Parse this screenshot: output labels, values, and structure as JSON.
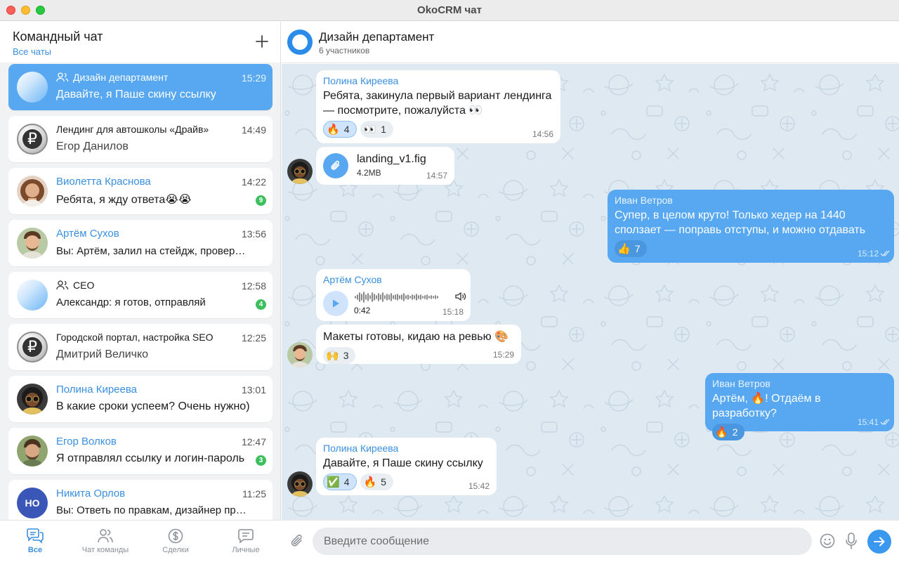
{
  "window": {
    "title": "OkoCRM чат"
  },
  "sidebar": {
    "title": "Командный чат",
    "subtitle": "Все чаты",
    "chats": [
      {
        "name": "Дизайн департамент",
        "time": "15:29",
        "preview": "Давайте, я Паше скину ссылку",
        "group": true,
        "active": true
      },
      {
        "name": "Лендинг для автошколы «Драйв»",
        "time": "14:49",
        "preview": "Егор Данилов"
      },
      {
        "name": "Виолетта Краснова",
        "time": "14:22",
        "preview": "Ребята, я жду ответа😭😭",
        "unread": "9"
      },
      {
        "name": "Артём Сухов",
        "time": "13:56",
        "preview": "Вы: Артём, залил на стейдж, проверь 😀"
      },
      {
        "name": "CEO",
        "time": "12:58",
        "preview": "Александр: я готов, отправляй",
        "group": true,
        "unread": "4"
      },
      {
        "name": "Городской портал, настройка SEO",
        "time": "12:25",
        "preview": "Дмитрий Величко"
      },
      {
        "name": "Полина Киреева",
        "time": "13:01",
        "preview": "В какие сроки успеем? Очень нужно)"
      },
      {
        "name": "Егор Волков",
        "time": "12:47",
        "preview": "Я отправлял ссылку и логин-пароль",
        "unread": "3"
      },
      {
        "name": "Никита Орлов",
        "time": "11:25",
        "preview": "Вы: Ответь по правкам, дизайнер просил",
        "initials": "НО"
      }
    ]
  },
  "bottom_nav": [
    {
      "label": "Все",
      "icon": "chats-icon",
      "active": true
    },
    {
      "label": "Чат команды",
      "icon": "team-icon"
    },
    {
      "label": "Сделки",
      "icon": "dollar-icon"
    },
    {
      "label": "Личные",
      "icon": "personal-chat-icon"
    }
  ],
  "chat": {
    "title": "Дизайн департамент",
    "subtitle": "6 участников",
    "messages": [
      {
        "author": "Полина Киреева",
        "text": "Ребята, закинула первый вариант лендинга — посмотрите, пожалуйста 👀",
        "time": "14:56",
        "reactions": [
          {
            "emoji": "🔥",
            "count": "4",
            "mine": true
          },
          {
            "emoji": "👀",
            "count": "1"
          }
        ]
      },
      {
        "file_name": "landing_v1.fig",
        "file_size": "4.2MB",
        "time": "14:57",
        "icon": "paperclip-icon"
      },
      {
        "author": "Иван Ветров",
        "text": "Супер, в целом круто! Только хедер на 1440 сползает — поправь отступы, и можно отдавать",
        "time": "15:12",
        "own": true,
        "reactions": [
          {
            "emoji": "👍",
            "count": "7"
          }
        ]
      },
      {
        "author": "Артём Сухов",
        "voice_duration": "0:42",
        "time": "15:18"
      },
      {
        "text": "Макеты готовы, кидаю на ревью 🎨",
        "time": "15:29",
        "reactions": [
          {
            "emoji": "🙌",
            "count": "3"
          }
        ]
      },
      {
        "author": "Иван Ветров",
        "text": "Артём, 🔥! Отдаём в разработку?",
        "time": "15:41",
        "own": true,
        "reactions": [
          {
            "emoji": "🔥",
            "count": "2"
          }
        ]
      },
      {
        "author": "Полина Киреева",
        "text": "Давайте, я Паше скину ссылку",
        "time": "15:42",
        "reactions": [
          {
            "emoji": "✅",
            "count": "4",
            "mine": true
          },
          {
            "emoji": "🔥",
            "count": "5"
          }
        ]
      }
    ]
  },
  "composer": {
    "placeholder": "Введите сообщение"
  },
  "colors": {
    "accent": "#3a8fe0",
    "own_bubble": "#57a8f0",
    "unread_badge": "#3cc05e",
    "chat_background": "#dfe9f1"
  }
}
